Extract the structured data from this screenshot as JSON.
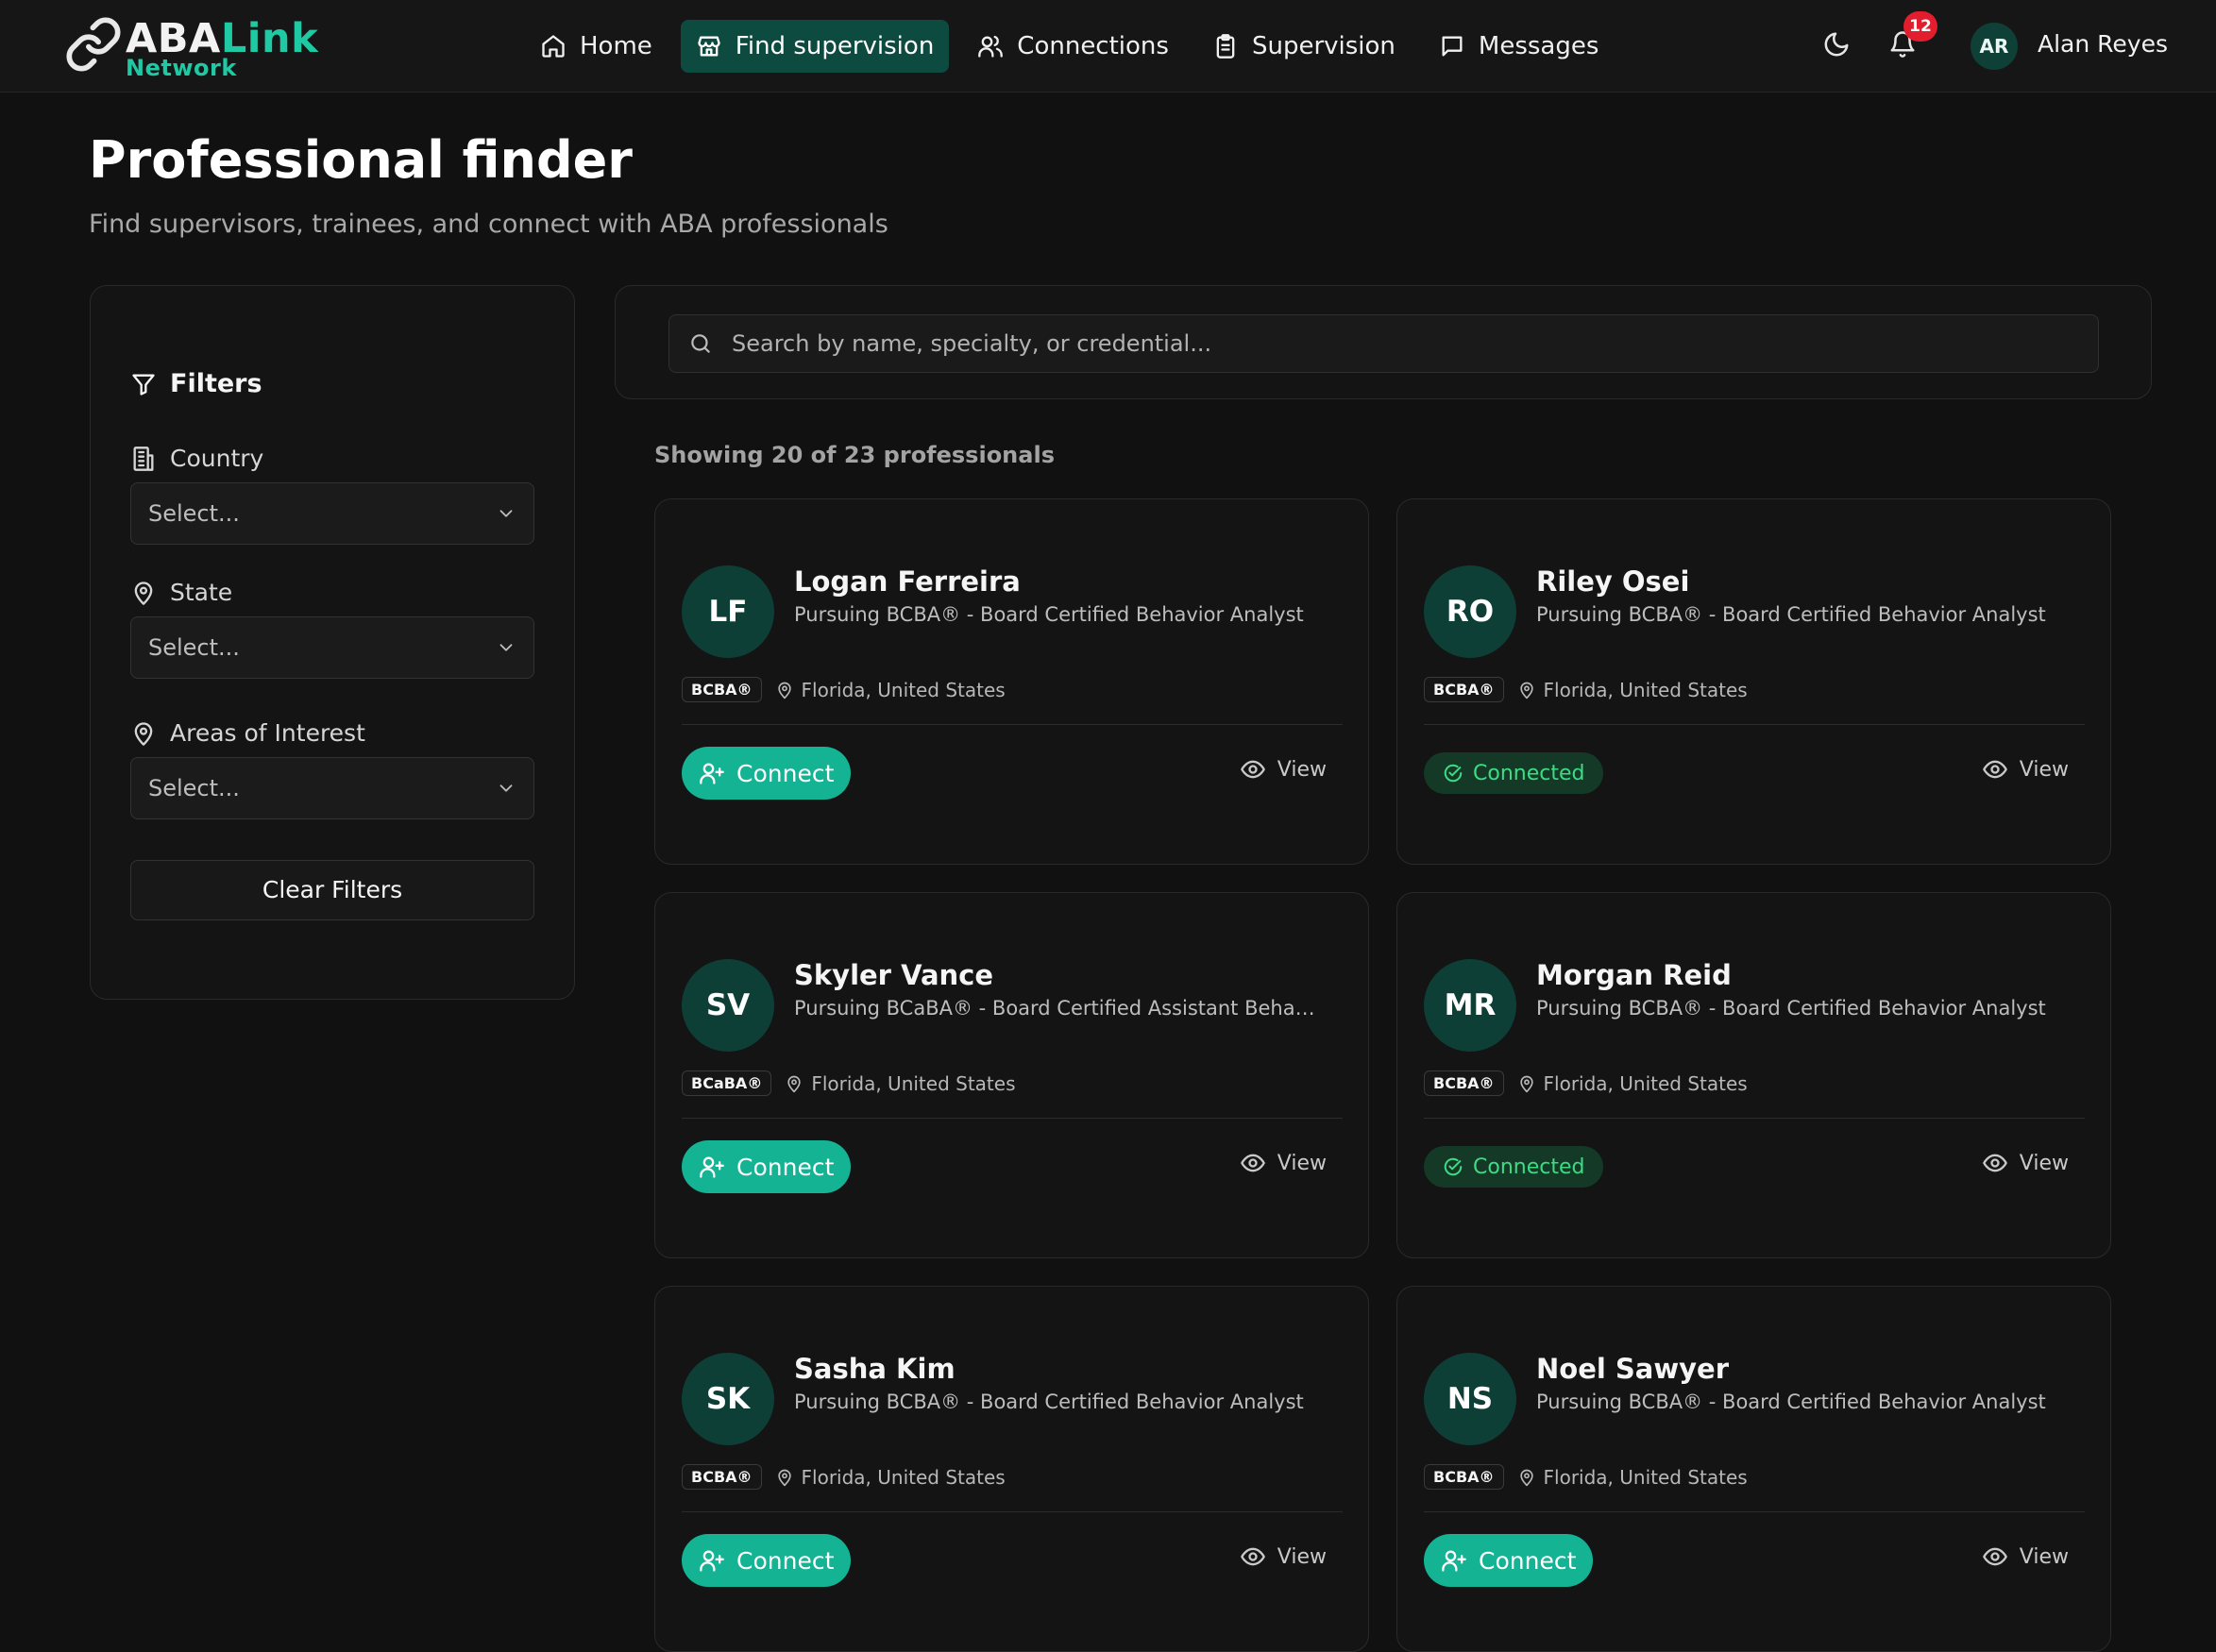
{
  "brand": {
    "name_primary": "ABA",
    "name_accent": "Link",
    "name_sub": "Network"
  },
  "nav": {
    "items": [
      {
        "label": "Home",
        "icon": "home-icon"
      },
      {
        "label": "Find supervision",
        "icon": "store-icon",
        "active": true
      },
      {
        "label": "Connections",
        "icon": "users-icon"
      },
      {
        "label": "Supervision",
        "icon": "clipboard-icon"
      },
      {
        "label": "Messages",
        "icon": "message-icon"
      }
    ]
  },
  "user": {
    "initials": "AR",
    "name": "Alan Reyes",
    "notifications": "12"
  },
  "header": {
    "title": "Professional finder",
    "subtitle": "Find supervisors, trainees, and connect with ABA professionals"
  },
  "filters": {
    "title": "Filters",
    "country_label": "Country",
    "country_value": "Select...",
    "state_label": "State",
    "state_value": "Select...",
    "interest_label": "Areas of Interest",
    "interest_value": "Select...",
    "clear_label": "Clear Filters"
  },
  "search": {
    "placeholder": "Search by name, specialty, or credential..."
  },
  "results": {
    "summary": "Showing 20 of 23 professionals"
  },
  "actions": {
    "connect": "Connect",
    "connected": "Connected",
    "view": "View"
  },
  "professionals": [
    {
      "initials": "LF",
      "name": "Logan Ferreira",
      "role": "Pursuing BCBA® - Board Certified Behavior Analyst",
      "credential": "BCBA®",
      "location": "Florida, United States",
      "status": "connect"
    },
    {
      "initials": "RO",
      "name": "Riley Osei",
      "role": "Pursuing BCBA® - Board Certified Behavior Analyst",
      "credential": "BCBA®",
      "location": "Florida, United States",
      "status": "connected"
    },
    {
      "initials": "SV",
      "name": "Skyler Vance",
      "role": "Pursuing BCaBA® - Board Certified Assistant Behavior...",
      "credential": "BCaBA®",
      "location": "Florida, United States",
      "status": "connect"
    },
    {
      "initials": "MR",
      "name": "Morgan Reid",
      "role": "Pursuing BCBA® - Board Certified Behavior Analyst",
      "credential": "BCBA®",
      "location": "Florida, United States",
      "status": "connected"
    },
    {
      "initials": "SK",
      "name": "Sasha Kim",
      "role": "Pursuing BCBA® - Board Certified Behavior Analyst",
      "credential": "BCBA®",
      "location": "Florida, United States",
      "status": "connect"
    },
    {
      "initials": "NS",
      "name": "Noel Sawyer",
      "role": "Pursuing BCBA® - Board Certified Behavior Analyst",
      "credential": "BCBA®",
      "location": "Florida, United States",
      "status": "connect"
    }
  ],
  "colors": {
    "accent": "#14b394",
    "accent_dark": "#0d4a40",
    "connected": "#3ddc84",
    "badge": "#e11d2e"
  }
}
